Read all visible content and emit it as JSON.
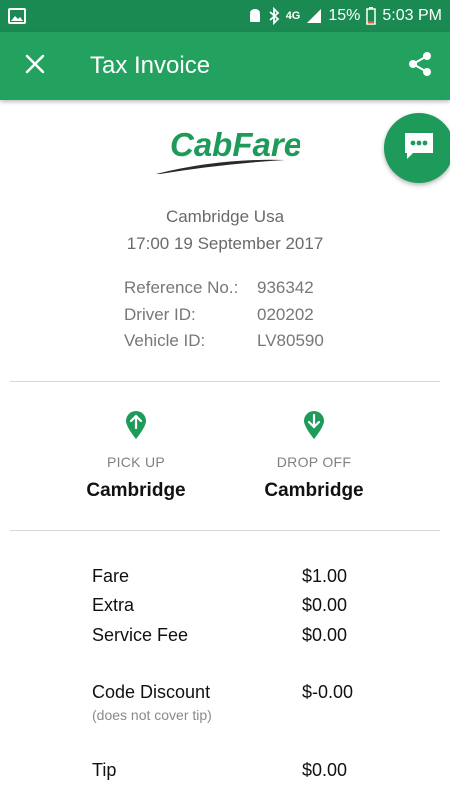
{
  "status_bar": {
    "battery": "15%",
    "time": "5:03 PM",
    "network": "4G"
  },
  "app_bar": {
    "title": "Tax Invoice",
    "color": "#22a15f"
  },
  "logo": {
    "text": "CabFare",
    "color": "#1e9a5a"
  },
  "invoice": {
    "location": "Cambridge Usa",
    "datetime": "17:00 19 September 2017",
    "reference_label": "Reference No.:",
    "reference_value": "936342",
    "driver_label": "Driver ID:",
    "driver_value": "020202",
    "vehicle_label": "Vehicle ID:",
    "vehicle_value": "LV80590"
  },
  "trip": {
    "pickup_label": "PICK UP",
    "pickup_place": "Cambridge",
    "dropoff_label": "DROP OFF",
    "dropoff_place": "Cambridge"
  },
  "fees": {
    "fare_label": "Fare",
    "fare_value": "$1.00",
    "extra_label": "Extra",
    "extra_value": "$0.00",
    "service_label": "Service Fee",
    "service_value": "$0.00",
    "discount_label": "Code Discount",
    "discount_value": "$-0.00",
    "discount_note": "(does not cover tip)",
    "tip_label": "Tip",
    "tip_value": "$0.00"
  },
  "icons": {
    "close": "close-icon",
    "share": "share-icon",
    "chat": "chat-icon",
    "pickup": "pickup-pin-icon",
    "dropoff": "dropoff-pin-icon"
  }
}
